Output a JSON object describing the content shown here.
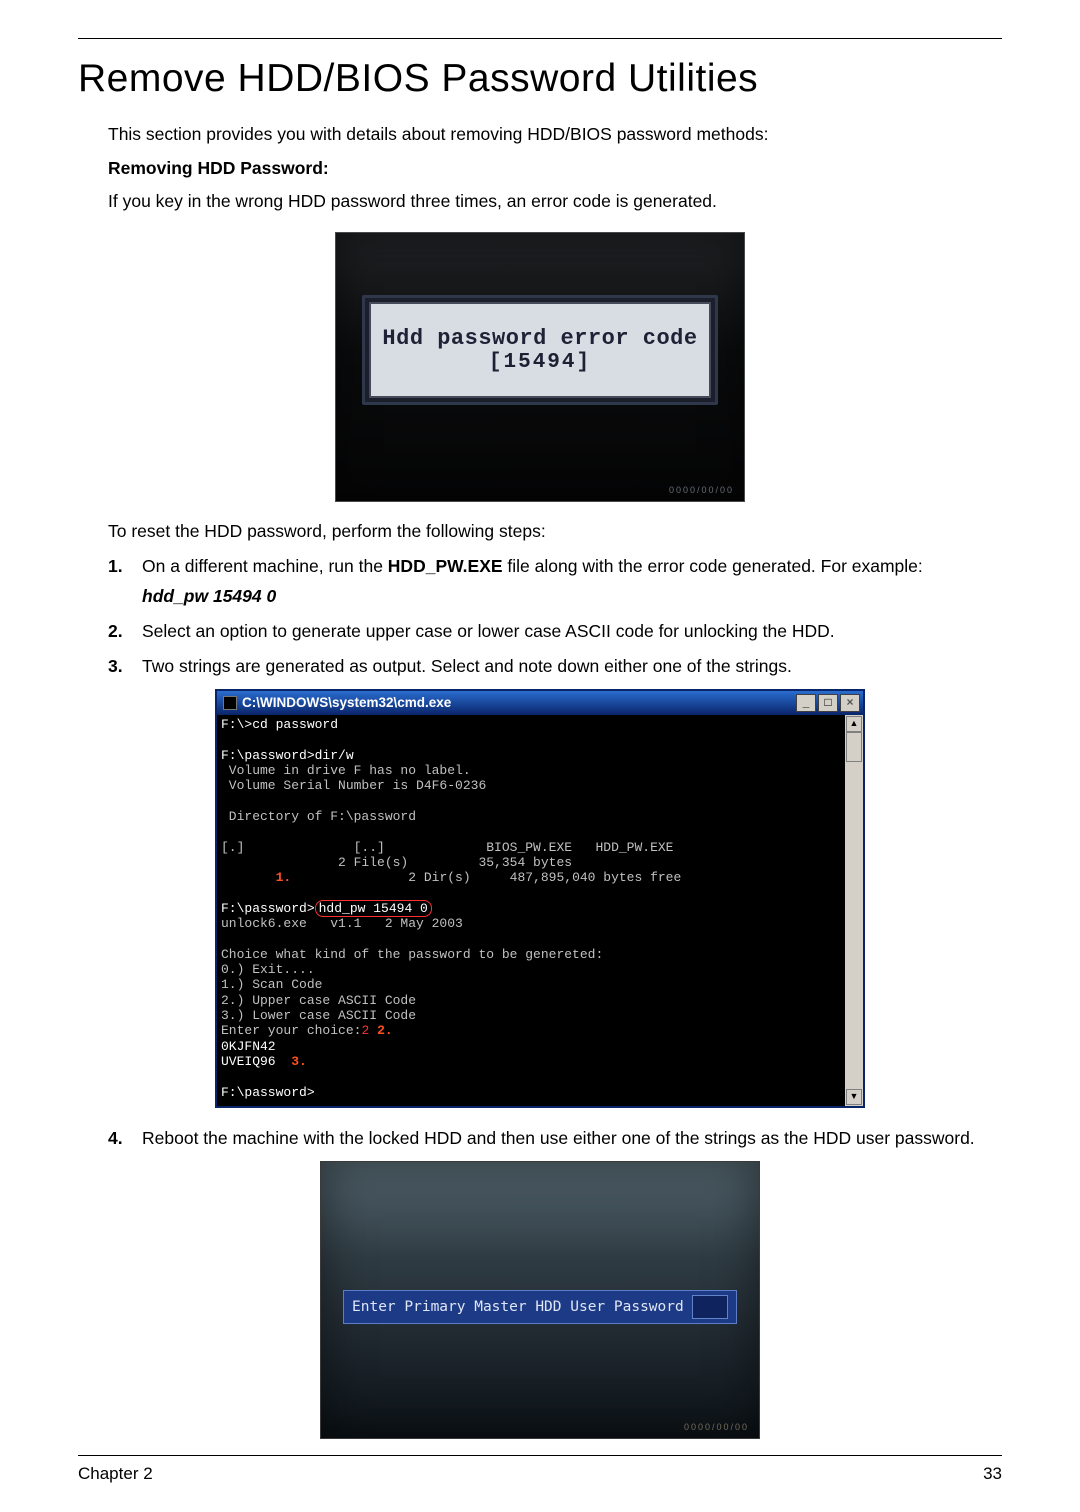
{
  "heading": "Remove HDD/BIOS Password Utilities",
  "intro": "This section provides you with details about removing HDD/BIOS password methods:",
  "subheading": "Removing HDD Password:",
  "error_intro": "If you key in the wrong HDD password three times, an error code is generated.",
  "fig1": {
    "line1": "Hdd password error code",
    "line2": "[15494]",
    "watermark": "0000/00/00"
  },
  "reset_intro": "To reset the HDD password, perform the following steps:",
  "steps": [
    {
      "n": "1.",
      "text_pre": "On a different machine, run the ",
      "bold": "HDD_PW.EXE",
      "text_post": " file along with the error code generated. For example:",
      "cmd": "hdd_pw 15494 0"
    },
    {
      "n": "2.",
      "text": "Select an option to generate upper case or lower case ASCII code for unlocking the HDD."
    },
    {
      "n": "3.",
      "text": "Two strings are generated as output. Select and note down either one of the strings."
    }
  ],
  "cmd_window": {
    "title": "C:\\WINDOWS\\system32\\cmd.exe",
    "buttons": {
      "min": "_",
      "max": "□",
      "close": "×"
    },
    "scrollbar": {
      "up": "▲",
      "down": "▼"
    },
    "line_cd": "F:\\>cd password",
    "line_dirw": "F:\\password>dir/w",
    "line_nolabel": " Volume in drive F has no label.",
    "line_serial": " Volume Serial Number is D4F6-0236",
    "line_dirof": " Directory of F:\\password",
    "line_files1": "[.]              [..]             BIOS_PW.EXE   HDD_PW.EXE",
    "line_files2": "               2 File(s)         35,354 bytes",
    "callout1": "1.",
    "line_files3": "               2 Dir(s)     487,895,040 bytes free",
    "line_prompt2a": "F:\\password>",
    "hl_cmd": "hdd_pw 15494 0",
    "line_unlock": "unlock6.exe   v1.1   2 May 2003",
    "line_choice_hdr": "Choice what kind of the password to be genereted:",
    "line_choice0": "0.) Exit....",
    "line_choice1": "1.) Scan Code",
    "line_choice2": "2.) Upper case ASCII Code",
    "line_choice3": "3.) Lower case ASCII Code",
    "line_enter_pre": "Enter your choice:",
    "line_enter_sel": "2",
    "callout2": "2.",
    "out1": "0KJFN42",
    "out2": "UVEIQ96",
    "callout3": "3.",
    "line_prompt3": "F:\\password>"
  },
  "step4": {
    "n": "4.",
    "text": "Reboot the machine with the locked HDD and then use either one of the strings as the HDD user password."
  },
  "fig3": {
    "label": "Enter Primary Master HDD User Password",
    "field": "[          ]",
    "watermark": "0000/00/00"
  },
  "footer": {
    "left": "Chapter 2",
    "right": "33"
  }
}
